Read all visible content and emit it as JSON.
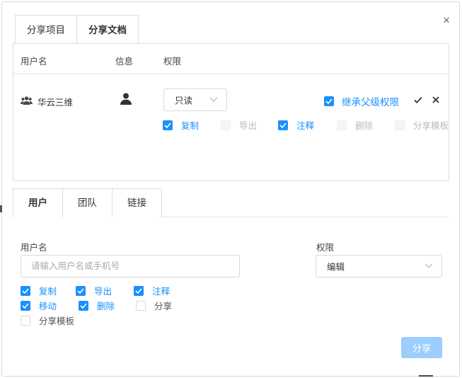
{
  "dialog": {
    "close_label": "×"
  },
  "top_tabs": [
    {
      "label": "分享项目",
      "active": false
    },
    {
      "label": "分享文档",
      "active": true
    }
  ],
  "permissions_table": {
    "headers": {
      "user": "用户名",
      "info": "信息",
      "permission": "权限"
    },
    "row": {
      "user_icon": "team-icon",
      "user_name": "华云三维",
      "info_icon": "person-icon",
      "permission_select": "只读",
      "inherit": {
        "label": "继承父级权限",
        "checked": true
      },
      "actions": {
        "confirm_icon": "check-icon",
        "remove_icon": "close-icon"
      },
      "options": [
        {
          "label": "复制",
          "checked": true,
          "disabled": false
        },
        {
          "label": "导出",
          "checked": false,
          "disabled": true
        },
        {
          "label": "注释",
          "checked": true,
          "disabled": false
        },
        {
          "label": "删除",
          "checked": false,
          "disabled": true
        },
        {
          "label": "分享模板",
          "checked": false,
          "disabled": true
        }
      ]
    }
  },
  "bottom_tabs": [
    {
      "label": "用户",
      "active": true
    },
    {
      "label": "团队",
      "active": false
    },
    {
      "label": "链接",
      "active": false
    }
  ],
  "add_user": {
    "username_label": "用户名",
    "username_placeholder": "请输入用户名或手机号",
    "username_value": "",
    "permission_label": "权限",
    "permission_select": "编辑",
    "options": [
      {
        "label": "复制",
        "checked": true
      },
      {
        "label": "导出",
        "checked": true
      },
      {
        "label": "注释",
        "checked": true
      },
      {
        "label": "移动",
        "checked": true
      },
      {
        "label": "删除",
        "checked": true
      },
      {
        "label": "分享",
        "checked": false
      },
      {
        "label": "分享模板",
        "checked": false
      }
    ],
    "share_button": "分享"
  },
  "colors": {
    "accent": "#1890ff",
    "accent_disabled": "#9ccdfc",
    "border": "#d9d9d9"
  }
}
